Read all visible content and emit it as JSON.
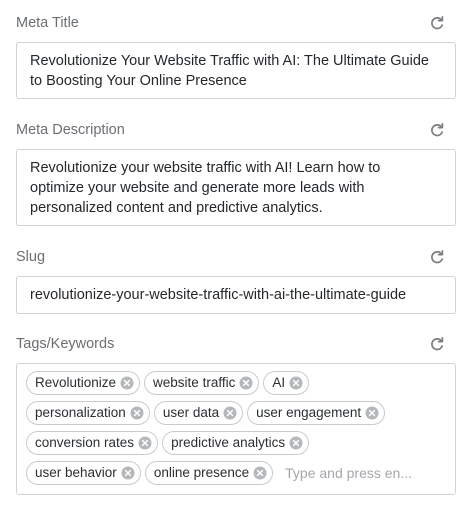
{
  "meta_title": {
    "label": "Meta Title",
    "line1": "Revolutionize Your Website Traffic with AI: The Ultimate Guide",
    "line2": "to Boosting Your Online Presence"
  },
  "meta_description": {
    "label": "Meta Description",
    "line1": "Revolutionize your website traffic with AI! Learn how to",
    "line2": "optimize your website and generate more leads with",
    "line3": "personalized content and predictive analytics."
  },
  "slug": {
    "label": "Slug",
    "value": "revolutionize-your-website-traffic-with-ai-the-ultimate-guide"
  },
  "tags": {
    "label": "Tags/Keywords",
    "items": [
      "Revolutionize",
      "website traffic",
      "AI",
      "personalization",
      "user data",
      "user engagement",
      "conversion rates",
      "predictive analytics",
      "user behavior",
      "online presence"
    ],
    "placeholder": "Type and press en..."
  },
  "icons": {
    "refresh": "refresh-icon",
    "remove": "close-circle-icon"
  },
  "colors": {
    "label": "#6b6f73",
    "border": "#cfd3d6",
    "icon": "#7a7e82",
    "tag_close": "#b4b8bb",
    "placeholder": "#a3a7ab"
  }
}
